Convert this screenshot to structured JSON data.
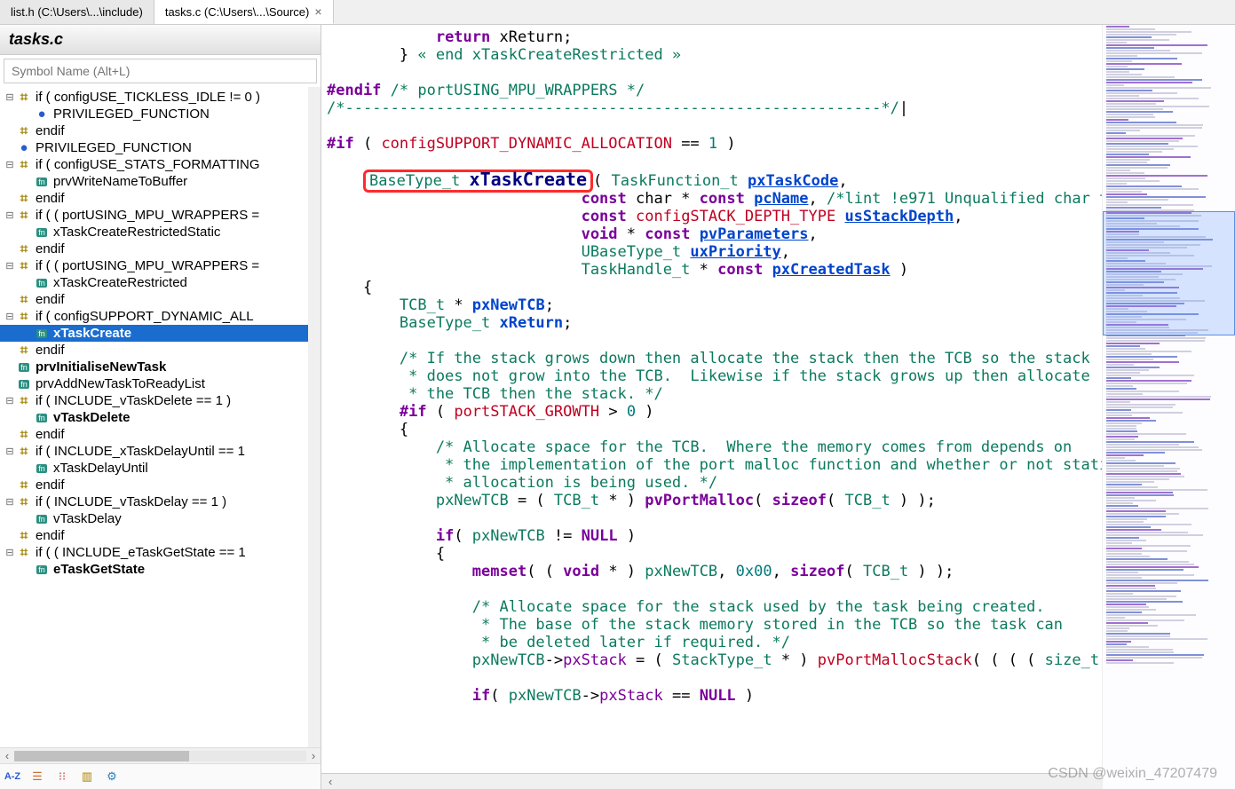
{
  "tabs": [
    {
      "label": "list.h (C:\\Users\\...\\include)",
      "active": false,
      "closable": false
    },
    {
      "label": "tasks.c (C:\\Users\\...\\Source)",
      "active": true,
      "closable": true
    }
  ],
  "panel": {
    "title": "tasks.c",
    "search_placeholder": "Symbol Name (Alt+L)"
  },
  "tree": [
    {
      "indent": 0,
      "expander": "−",
      "icon": "hash",
      "label": "if ( configUSE_TICKLESS_IDLE != 0 )",
      "bold": false
    },
    {
      "indent": 1,
      "expander": "",
      "icon": "globe",
      "label": "PRIVILEGED_FUNCTION",
      "bold": false
    },
    {
      "indent": 0,
      "expander": "",
      "icon": "hash",
      "label": "endif",
      "bold": false
    },
    {
      "indent": 0,
      "expander": "",
      "icon": "globe",
      "label": "PRIVILEGED_FUNCTION",
      "bold": false
    },
    {
      "indent": 0,
      "expander": "−",
      "icon": "hash",
      "label": "if ( configUSE_STATS_FORMATTING",
      "bold": false
    },
    {
      "indent": 1,
      "expander": "",
      "icon": "func",
      "label": "prvWriteNameToBuffer",
      "bold": false
    },
    {
      "indent": 0,
      "expander": "",
      "icon": "hash",
      "label": "endif",
      "bold": false
    },
    {
      "indent": 0,
      "expander": "−",
      "icon": "hash",
      "label": "if ( ( portUSING_MPU_WRAPPERS =",
      "bold": false
    },
    {
      "indent": 1,
      "expander": "",
      "icon": "func",
      "label": "xTaskCreateRestrictedStatic",
      "bold": false
    },
    {
      "indent": 0,
      "expander": "",
      "icon": "hash",
      "label": "endif",
      "bold": false
    },
    {
      "indent": 0,
      "expander": "−",
      "icon": "hash",
      "label": "if ( ( portUSING_MPU_WRAPPERS =",
      "bold": false
    },
    {
      "indent": 1,
      "expander": "",
      "icon": "func",
      "label": "xTaskCreateRestricted",
      "bold": false
    },
    {
      "indent": 0,
      "expander": "",
      "icon": "hash",
      "label": "endif",
      "bold": false
    },
    {
      "indent": 0,
      "expander": "−",
      "icon": "hash",
      "label": "if ( configSUPPORT_DYNAMIC_ALL",
      "bold": false
    },
    {
      "indent": 1,
      "expander": "",
      "icon": "func",
      "label": "xTaskCreate",
      "bold": true,
      "selected": true
    },
    {
      "indent": 0,
      "expander": "",
      "icon": "hash",
      "label": "endif",
      "bold": false
    },
    {
      "indent": 0,
      "expander": "",
      "icon": "func",
      "label": "prvInitialiseNewTask",
      "bold": true
    },
    {
      "indent": 0,
      "expander": "",
      "icon": "func",
      "label": "prvAddNewTaskToReadyList",
      "bold": false
    },
    {
      "indent": 0,
      "expander": "−",
      "icon": "hash",
      "label": "if ( INCLUDE_vTaskDelete == 1 )",
      "bold": false
    },
    {
      "indent": 1,
      "expander": "",
      "icon": "func",
      "label": "vTaskDelete",
      "bold": true
    },
    {
      "indent": 0,
      "expander": "",
      "icon": "hash",
      "label": "endif",
      "bold": false
    },
    {
      "indent": 0,
      "expander": "−",
      "icon": "hash",
      "label": "if ( INCLUDE_xTaskDelayUntil == 1",
      "bold": false
    },
    {
      "indent": 1,
      "expander": "",
      "icon": "func",
      "label": "xTaskDelayUntil",
      "bold": false
    },
    {
      "indent": 0,
      "expander": "",
      "icon": "hash",
      "label": "endif",
      "bold": false
    },
    {
      "indent": 0,
      "expander": "−",
      "icon": "hash",
      "label": "if ( INCLUDE_vTaskDelay == 1 )",
      "bold": false
    },
    {
      "indent": 1,
      "expander": "",
      "icon": "func",
      "label": "vTaskDelay",
      "bold": false
    },
    {
      "indent": 0,
      "expander": "",
      "icon": "hash",
      "label": "endif",
      "bold": false
    },
    {
      "indent": 0,
      "expander": "−",
      "icon": "hash",
      "label": "if ( ( INCLUDE_eTaskGetState == 1",
      "bold": false
    },
    {
      "indent": 1,
      "expander": "",
      "icon": "func",
      "label": "eTaskGetState",
      "bold": true
    }
  ],
  "bottom_toolbar_icons": [
    "az-icon",
    "list-icon",
    "tree-icon",
    "book-icon",
    "gear-icon"
  ],
  "code": {
    "l1a": "            ",
    "l1b": "return",
    "l1c": " xReturn;",
    "l2a": "        } ",
    "l2b": "« end xTaskCreateRestricted »",
    "l3": "",
    "l4a": "#endif",
    "l4b": " /* portUSING_MPU_WRAPPERS */",
    "l5a": "/*",
    "l5b": "-----------------------------------------------------------",
    "l5c": "*/",
    "l6": "",
    "l7a": "#if",
    "l7b": " ( ",
    "l7c": "configSUPPORT_DYNAMIC_ALLOCATION",
    "l7d": " == ",
    "l7e": "1",
    "l7f": " )",
    "l8": "",
    "l9a": "    ",
    "l9b": "BaseType_t ",
    "l9c": "xTaskCreate",
    "l9d": "( ",
    "l9e": "TaskFunction_t ",
    "l9f": "pxTaskCode",
    "l9g": ",",
    "l10a": "                            ",
    "l10b": "const",
    "l10c": " char * ",
    "l10d": "const",
    "l10e": " ",
    "l10f": "pcName",
    "l10g": ", ",
    "l10h": "/*lint !e971 Unqualified char t",
    "l11a": "                            ",
    "l11b": "const",
    "l11c": " ",
    "l11d": "configSTACK_DEPTH_TYPE",
    "l11e": " ",
    "l11f": "usStackDepth",
    "l11g": ",",
    "l12a": "                            ",
    "l12b": "void",
    "l12c": " * ",
    "l12d": "const",
    "l12e": " ",
    "l12f": "pvParameters",
    "l12g": ",",
    "l13a": "                            ",
    "l13b": "UBaseType_t ",
    "l13c": "uxPriority",
    "l13d": ",",
    "l14a": "                            ",
    "l14b": "TaskHandle_t ",
    "l14c": "* ",
    "l14d": "const",
    "l14e": " ",
    "l14f": "pxCreatedTask",
    "l14g": " )",
    "l15": "    {",
    "l16a": "        ",
    "l16b": "TCB_t",
    "l16c": " * ",
    "l16d": "pxNewTCB",
    "l16e": ";",
    "l17a": "        ",
    "l17b": "BaseType_t ",
    "l17c": "xReturn",
    "l17d": ";",
    "l18": "",
    "l19": "        /* If the stack grows down then allocate the stack then the TCB so the stack",
    "l20": "         * does not grow into the TCB.  Likewise if the stack grows up then allocate",
    "l21": "         * the TCB then the stack. */",
    "l22a": "        ",
    "l22b": "#if",
    "l22c": " ( ",
    "l22d": "portSTACK_GROWTH",
    "l22e": " > ",
    "l22f": "0",
    "l22g": " )",
    "l23": "        {",
    "l24": "            /* Allocate space for the TCB.  Where the memory comes from depends on",
    "l25": "             * the implementation of the port malloc function and whether or not stati",
    "l26": "             * allocation is being used. */",
    "l27a": "            ",
    "l27b": "pxNewTCB",
    "l27c": " = ( ",
    "l27d": "TCB_t",
    "l27e": " * ) ",
    "l27f": "pvPortMalloc",
    "l27g": "( ",
    "l27h": "sizeof",
    "l27i": "( ",
    "l27j": "TCB_t",
    "l27k": " ) );",
    "l28": "",
    "l29a": "            ",
    "l29b": "if",
    "l29c": "( ",
    "l29d": "pxNewTCB",
    "l29e": " != ",
    "l29f": "NULL",
    "l29g": " )",
    "l30": "            {",
    "l31a": "                ",
    "l31b": "memset",
    "l31c": "( ( ",
    "l31d": "void",
    "l31e": " * ) ",
    "l31f": "pxNewTCB",
    "l31g": ", ",
    "l31h": "0x00",
    "l31i": ", ",
    "l31j": "sizeof",
    "l31k": "( ",
    "l31l": "TCB_t",
    "l31m": " ) );",
    "l32": "",
    "l33": "                /* Allocate space for the stack used by the task being created.",
    "l34": "                 * The base of the stack memory stored in the TCB so the task can",
    "l35": "                 * be deleted later if required. */",
    "l36a": "                ",
    "l36b": "pxNewTCB",
    "l36c": "->",
    "l36d": "pxStack",
    "l36e": " = ( ",
    "l36f": "StackType_t",
    "l36g": " * ) ",
    "l36h": "pvPortMallocStack",
    "l36i": "( ( ( ( ",
    "l36j": "size_t",
    "l37": "",
    "l38a": "                ",
    "l38b": "if",
    "l38c": "( ",
    "l38d": "pxNewTCB",
    "l38e": "->",
    "l38f": "pxStack",
    "l38g": " == ",
    "l38h": "NULL",
    "l38i": " )"
  },
  "watermark": "CSDN @weixin_47207479"
}
